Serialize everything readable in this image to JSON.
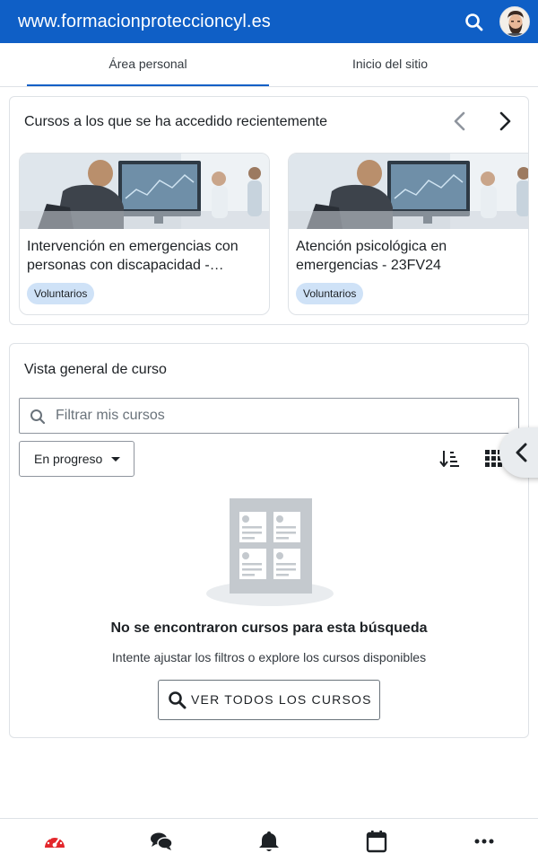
{
  "header": {
    "site_title": "www.formacionproteccioncyl.es",
    "search_icon": "search-icon",
    "avatar": "user-avatar"
  },
  "tabs": [
    {
      "label": "Área personal",
      "active": true
    },
    {
      "label": "Inicio del sitio",
      "active": false
    }
  ],
  "recent_courses": {
    "title": "Cursos a los que se ha accedido recientemente",
    "prev_icon": "chevron-left-icon",
    "next_icon": "chevron-right-icon",
    "items": [
      {
        "name": "Intervención en emergencias con personas con discapacidad -…",
        "badge": "Voluntarios"
      },
      {
        "name": "Atención psicológica en emergencias - 23FV24",
        "badge": "Voluntarios"
      }
    ]
  },
  "course_overview": {
    "title": "Vista general de curso",
    "search_placeholder": "Filtrar mis cursos",
    "search_value": "",
    "filter_selected": "En progreso",
    "sort_icon": "sort-icon",
    "view_icon": "grid-view-icon",
    "empty_title": "No se encontraron cursos para esta búsqueda",
    "empty_subtitle": "Intente ajustar los filtros o explore los cursos disponibles",
    "view_all_button": "VER TODOS LOS CURSOS"
  },
  "drawer_toggle_icon": "chevron-left-icon",
  "bottom_nav": [
    {
      "name": "dashboard-icon",
      "color": "#e3262b"
    },
    {
      "name": "messages-icon",
      "color": "#1d2125"
    },
    {
      "name": "notifications-icon",
      "color": "#1d2125"
    },
    {
      "name": "calendar-icon",
      "color": "#1d2125"
    },
    {
      "name": "more-icon",
      "color": "#1d2125"
    }
  ],
  "colors": {
    "brand": "#0f5fc6",
    "badge_bg": "#cfe2f7"
  }
}
